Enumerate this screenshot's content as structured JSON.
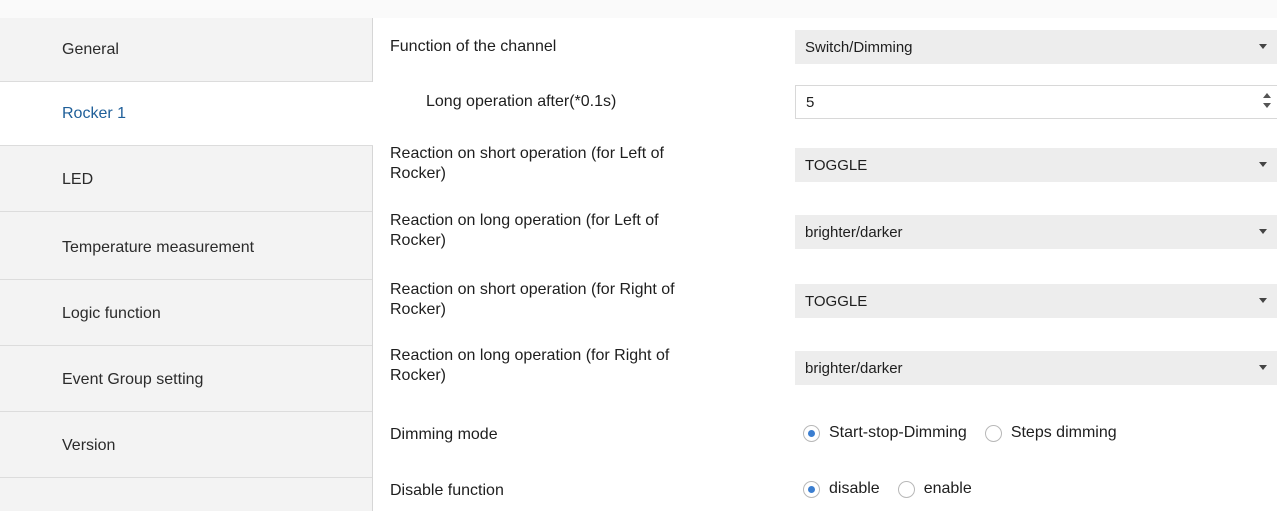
{
  "sidebar": {
    "items": [
      {
        "label": "General"
      },
      {
        "label": "Rocker 1"
      },
      {
        "label": "LED"
      },
      {
        "label": "Temperature measurement"
      },
      {
        "label": "Logic function"
      },
      {
        "label": "Event Group setting"
      },
      {
        "label": "Version"
      }
    ],
    "active": "Rocker 1"
  },
  "params": {
    "function_channel": {
      "label": "Function of the channel",
      "value": "Switch/Dimming"
    },
    "long_operation": {
      "label": "Long operation after(*0.1s)",
      "value": "5"
    },
    "short_left": {
      "label_line1": "Reaction on short operation (for Left of",
      "label_line2": "Rocker)",
      "value": "TOGGLE"
    },
    "long_left": {
      "label_line1": "Reaction on long operation (for Left of",
      "label_line2": "Rocker)",
      "value": "brighter/darker"
    },
    "short_right": {
      "label_line1": "Reaction on short operation (for Right of",
      "label_line2": "Rocker)",
      "value": "TOGGLE"
    },
    "long_right": {
      "label_line1": "Reaction on long operation (for Right of",
      "label_line2": "Rocker)",
      "value": "brighter/darker"
    },
    "dimming_mode": {
      "label": "Dimming mode",
      "options": [
        "Start-stop-Dimming",
        "Steps dimming"
      ],
      "selected": "Start-stop-Dimming"
    },
    "disable_function": {
      "label": "Disable function",
      "options": [
        "disable",
        "enable"
      ],
      "selected": "disable"
    }
  },
  "colors": {
    "active_nav_text": "#1f5f99",
    "radio_selected": "#3b7ed0",
    "dropdown_bg": "#ededed",
    "sidebar_bg": "#f3f3f3"
  }
}
